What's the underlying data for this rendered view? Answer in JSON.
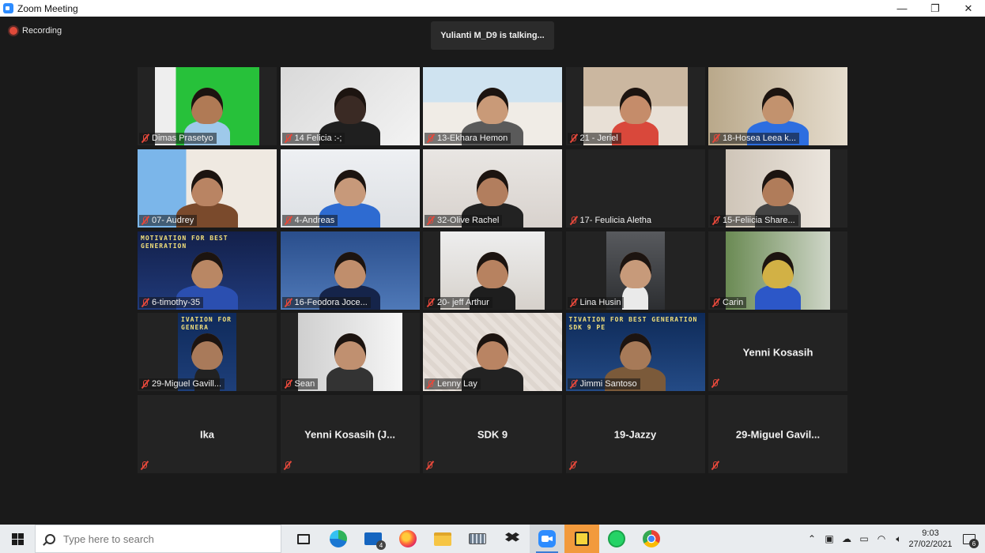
{
  "window": {
    "title": "Zoom Meeting",
    "minimize_glyph": "—",
    "restore_glyph": "❐",
    "close_glyph": "✕"
  },
  "meeting": {
    "recording_label": "Recording",
    "talking_banner": "Yulianti M_D9 is talking..."
  },
  "participants": [
    {
      "name": "Dimas Prasetyo",
      "video": true
    },
    {
      "name": "14 Felicia :-;",
      "video": true
    },
    {
      "name": "13-Ekhara Hemon",
      "video": true
    },
    {
      "name": "21 - Jeriel",
      "video": true
    },
    {
      "name": "18-Hosea Leea k...",
      "video": true
    },
    {
      "name": "07- Audrey",
      "video": true
    },
    {
      "name": "4-Andreas",
      "video": true
    },
    {
      "name": "32-Olive Rachel",
      "video": true
    },
    {
      "name": "17- Feulicia Aletha",
      "video": false,
      "show_center": false
    },
    {
      "name": "15-Feliicia Share...",
      "video": true
    },
    {
      "name": "6-timothy-35",
      "video": true,
      "overlay_text": "MOTIVATION FOR BEST GENERATION"
    },
    {
      "name": "16-Feodora Joce...",
      "video": true
    },
    {
      "name": "20- jeff Arthur",
      "video": true
    },
    {
      "name": "Lina Husin",
      "video": true
    },
    {
      "name": "Carin",
      "video": true
    },
    {
      "name": "29-Miguel Gavill...",
      "video": true,
      "overlay_text": "IVATION FOR GENERA"
    },
    {
      "name": "Sean",
      "video": true
    },
    {
      "name": "Lenny Lay",
      "video": true
    },
    {
      "name": "Jimmi Santoso",
      "video": true,
      "overlay_text": "TIVATION FOR BEST GENERATION SDK 9 PE"
    },
    {
      "name": "Yenni Kosasih",
      "video": false
    },
    {
      "name": "Ika",
      "video": false
    },
    {
      "name": "Yenni Kosasih (J...",
      "video": false
    },
    {
      "name": "SDK 9",
      "video": false
    },
    {
      "name": "19-Jazzy",
      "video": false
    },
    {
      "name": "29-Miguel  Gavil...",
      "video": false
    }
  ],
  "taskbar": {
    "search_placeholder": "Type here to search",
    "mail_badge": "4",
    "time": "9:03",
    "date": "27/02/2021",
    "notification_count": "6",
    "icons": [
      "task-view-icon",
      "edge-icon",
      "mail-icon",
      "firefox-icon",
      "file-explorer-icon",
      "keyboard-app-icon",
      "dropbox-icon",
      "zoom-icon",
      "sticky-notes-icon",
      "whatsapp-icon",
      "chrome-icon"
    ]
  },
  "colors": {
    "background": "#1a1a1a",
    "tile": "#232323",
    "muted_red": "#e5483b",
    "zoom_blue": "#2d8cff",
    "taskbar": "#e9ecef"
  }
}
